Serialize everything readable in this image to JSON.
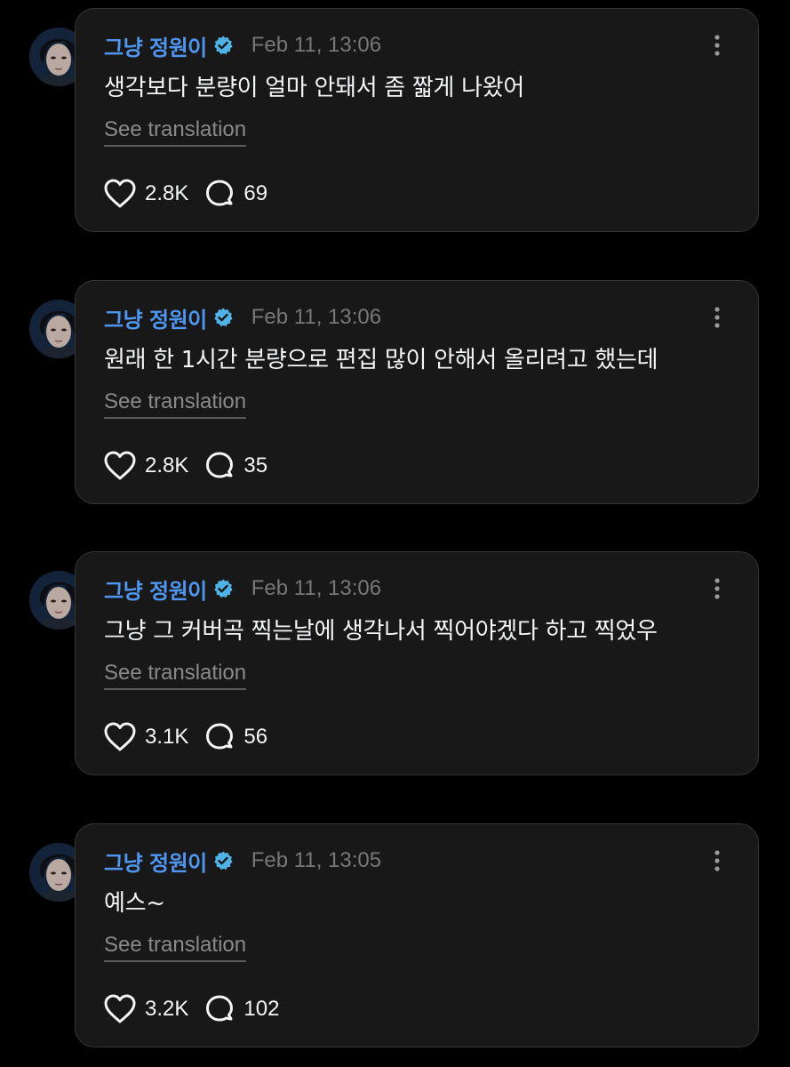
{
  "colors": {
    "background": "#000000",
    "card": "#181818",
    "card_border": "#353535",
    "username": "#4e96f0",
    "verified": "#4fb3e8",
    "timestamp": "#777777",
    "text": "#f3f5f7",
    "translation_link": "#8a8a8a"
  },
  "icons": {
    "verified": "verified-badge-icon",
    "more": "more-vertical-icon",
    "like": "heart-icon",
    "reply": "speech-bubble-icon"
  },
  "posts": [
    {
      "username": "그냥 정원이",
      "timestamp": "Feb 11, 13:06",
      "text": "생각보다 분량이 얼마 안돼서 좀 짧게 나왔어",
      "translate_label": "See translation",
      "likes": "2.8K",
      "replies": "69"
    },
    {
      "username": "그냥 정원이",
      "timestamp": "Feb 11, 13:06",
      "text": "원래 한 1시간 분량으로 편집 많이 안해서 올리려고 했는데",
      "translate_label": "See translation",
      "likes": "2.8K",
      "replies": "35"
    },
    {
      "username": "그냥 정원이",
      "timestamp": "Feb 11, 13:06",
      "text": "그냥 그 커버곡 찍는날에 생각나서 찍어야겠다 하고 찍었우",
      "translate_label": "See translation",
      "likes": "3.1K",
      "replies": "56"
    },
    {
      "username": "그냥 정원이",
      "timestamp": "Feb 11, 13:05",
      "text": "예스~",
      "translate_label": "See translation",
      "likes": "3.2K",
      "replies": "102"
    }
  ]
}
